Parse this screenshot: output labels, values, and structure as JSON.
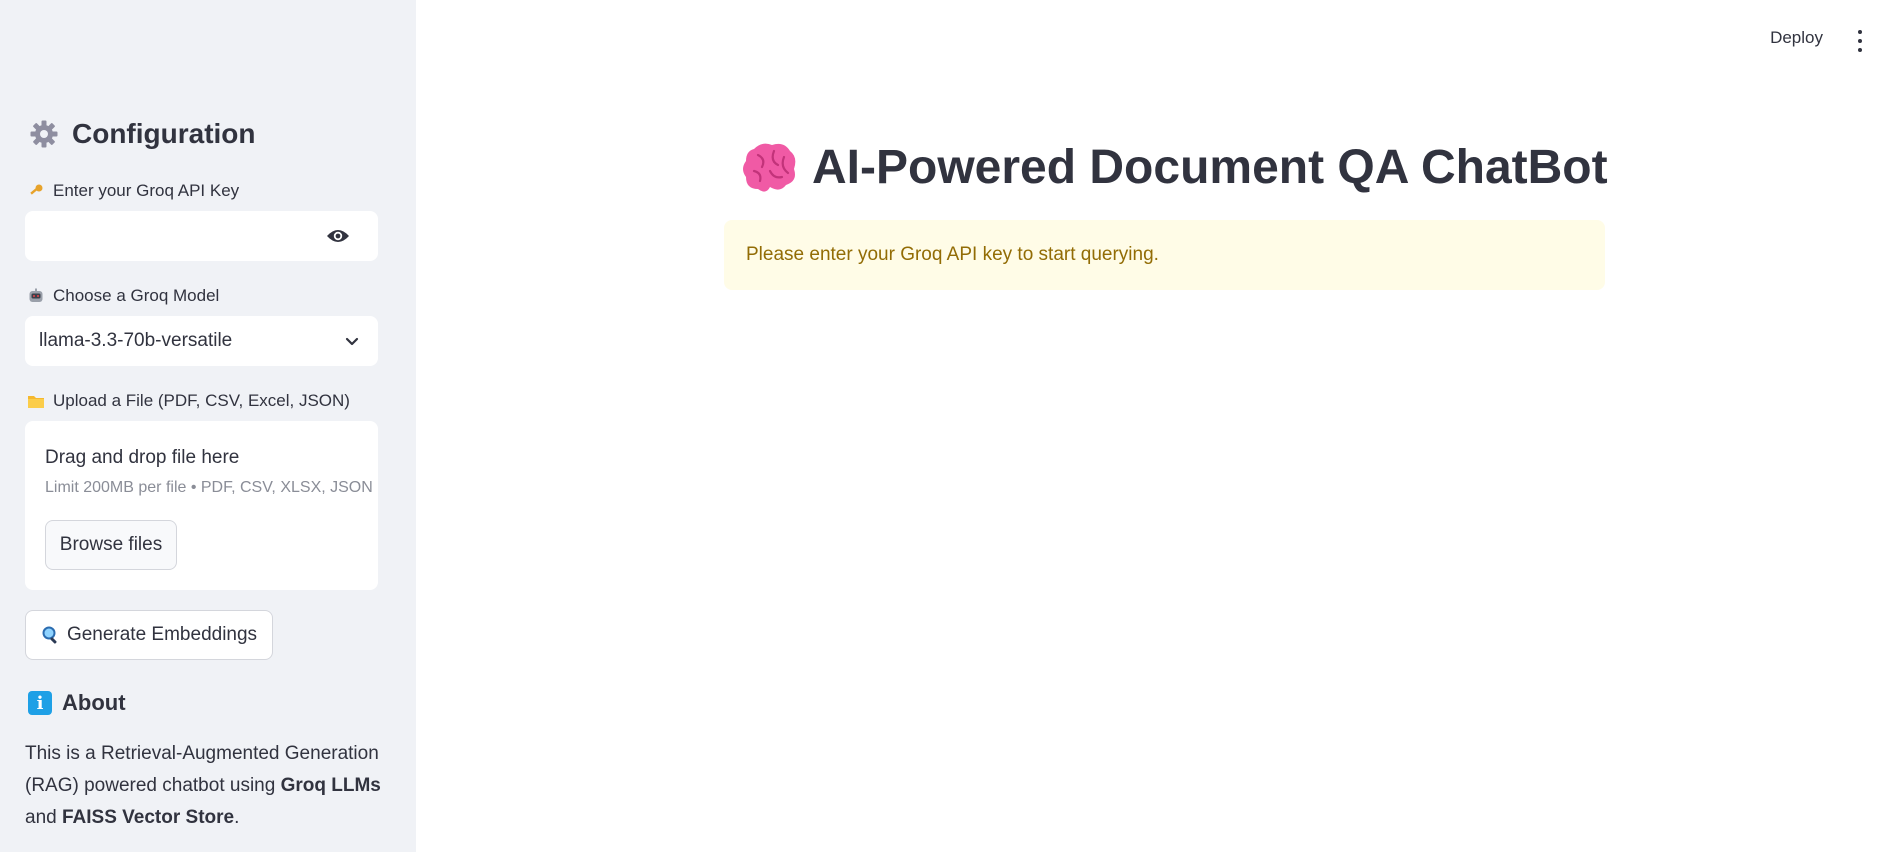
{
  "sidebar": {
    "title": "Configuration",
    "api_key": {
      "label": "Enter your Groq API Key",
      "value": ""
    },
    "model": {
      "label": "Choose a Groq Model",
      "selected": "llama-3.3-70b-versatile"
    },
    "upload": {
      "label": "Upload a File (PDF, CSV, Excel, JSON)",
      "drop_text": "Drag and drop file here",
      "limit_text": "Limit 200MB per file • PDF, CSV, XLSX, JSON",
      "browse_label": "Browse files"
    },
    "generate_label": "Generate Embeddings",
    "about": {
      "heading": "About",
      "text_1": "This is a Retrieval-Augmented Generation (RAG) powered chatbot using ",
      "bold_1": "Groq LLMs",
      "text_2": " and ",
      "bold_2": "FAISS Vector Store",
      "text_3": "."
    }
  },
  "header": {
    "deploy_label": "Deploy"
  },
  "main": {
    "title": "AI-Powered Document QA ChatBot",
    "warning": "Please enter your Groq API key to start querying."
  },
  "icons": {
    "gear": "gear-icon",
    "key": "key-icon",
    "robot": "robot-icon",
    "folder": "folder-icon",
    "search": "magnifier-icon",
    "info": "info-icon",
    "brain": "brain-icon",
    "eye": "eye-icon",
    "chevron": "chevron-down-icon",
    "menu": "vertical-dots-icon"
  },
  "colors": {
    "sidebar_bg": "#f0f2f6",
    "warning_bg": "#fffce7",
    "warning_text": "#926c05",
    "info_badge": "#1ea0e6",
    "brain_pink": "#f05aa5"
  }
}
